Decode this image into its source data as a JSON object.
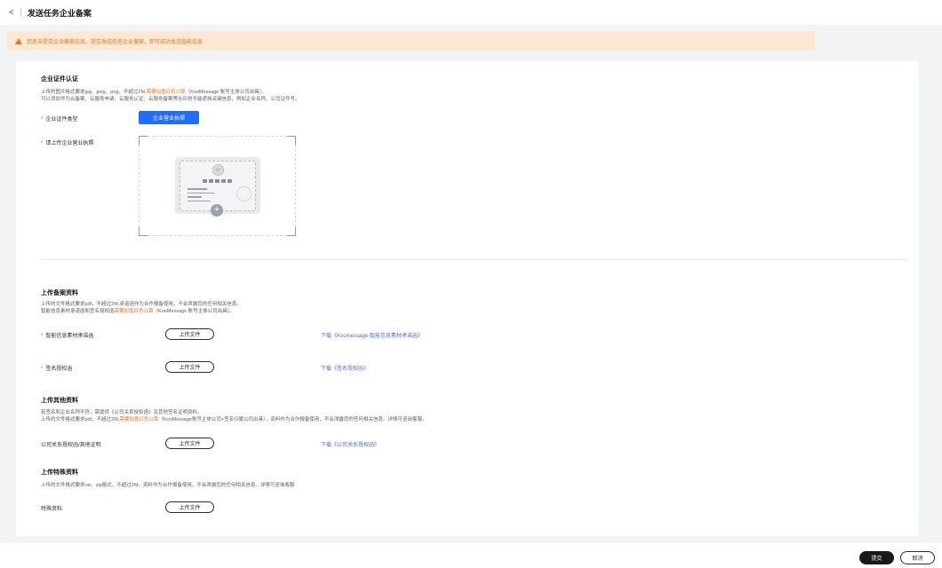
{
  "header": {
    "back_glyph": "<",
    "title": "发送任务企业备案"
  },
  "alert": {
    "text": "您还未提交企业备案信息，提交发送任务企业备案，即可成功发送智能信息"
  },
  "cert": {
    "heading": "企业证件认证",
    "desc1_a": "上传的图片格式要求jpg、jpeg、png，不超过2M,",
    "desc1_hl": "需要加盖红色公章",
    "desc1_b": "（KooMessage 账号主体公司出具）。",
    "desc2": "可以添加华为云备案、云服务申请、云服务认证、云服务备案等水印但不能遮挡关键信息，例如企业名称、公司证件号。",
    "type_label": "企业证件类型",
    "type_button": "企业营业执照",
    "upload_label": "请上传企业营业执照"
  },
  "filing": {
    "heading": "上传备案资料",
    "desc1": "上传的文件格式要求pdf，不超过2M,承诺函作为合作报备使用，不会泄露您的任何相关信息。",
    "desc2_a": "智能信息素材承诺函和签名授权函",
    "desc2_hl": "需要加盖红色公章",
    "desc2_b": "（KooMessage 账号主体公司出具）。",
    "rows": [
      {
        "label": "智能信息素材承诺函",
        "button": "上传文件",
        "link": "下载《Koomessage-智能信息素材承诺函》"
      },
      {
        "label": "签名授权函",
        "button": "上传文件",
        "link": "下载《签名授权函》"
      }
    ]
  },
  "other": {
    "heading": "上传其他资料",
    "desc1": "若签名和企业名称不符，需提供《公司关系授权函》及其他签名证明资料。",
    "desc2_a": "上传的文件格式要求pdf，不超过2M,",
    "desc2_hl": "需要加盖红色公章",
    "desc2_b": "（KooMessage账号主体公司+签名归属公司出具），资料作为合作报备使用，不会泄露您的任何相关信息。详情可咨询客服。",
    "label": "公司关系授权函/其他证明",
    "button": "上传文件",
    "link": "下载《公司关系授权函》"
  },
  "special": {
    "heading": "上传特殊资料",
    "desc": "上传的文件格式要求rar、zip格式，不超过2M，资料作为合作报备使用，不会泄露您的任何相关信息。详情可咨询客服",
    "label": "特殊资料",
    "button": "上传文件"
  },
  "footer": {
    "submit": "提交",
    "cancel": "取消"
  },
  "required_mark": "*",
  "icons": {
    "seal": "☺",
    "plus": "+"
  }
}
